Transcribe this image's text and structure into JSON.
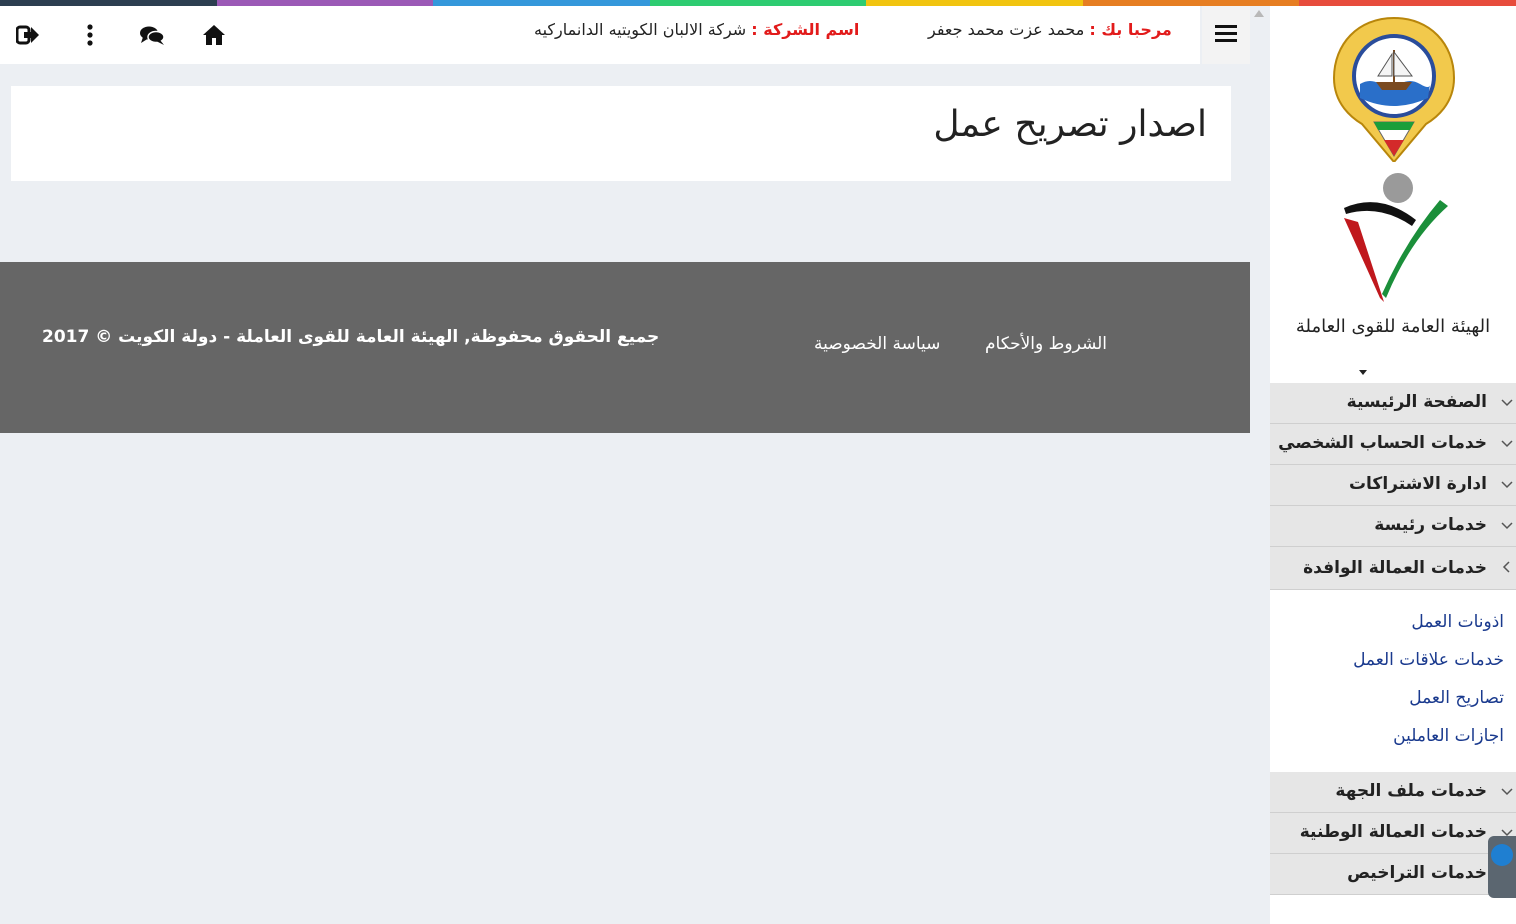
{
  "accent_colors": [
    "#2c3e50",
    "#9b59b6",
    "#3498db",
    "#2ecc71",
    "#f1c40f",
    "#e67e22",
    "#e74c3c"
  ],
  "header": {
    "welcome_label": "مرحبا بك :",
    "user_name": "محمد عزت محمد جعفر",
    "company_label": "اسم الشركة :",
    "company_name": "شركة الالبان الكويتيه الدانماركيه",
    "icons": [
      "logout-icon",
      "more-vertical-icon",
      "chat-icon",
      "home-icon",
      "hamburger-menu-icon"
    ]
  },
  "main": {
    "page_title": "اصدار تصريح عمل"
  },
  "footer": {
    "copyright": "جميع الحقوق محفوظة, الهيئة العامة للقوى العاملة - دولة الكويت © 2017",
    "links": [
      "الشروط والأحكام",
      "سياسة الخصوصية"
    ]
  },
  "sidebar": {
    "org_name": "الهيئة العامة للقوى العاملة",
    "items": [
      {
        "label": "الصفحة الرئيسية"
      },
      {
        "label": "خدمات الحساب الشخصي"
      },
      {
        "label": "ادارة الاشتراكات"
      },
      {
        "label": "خدمات رئيسة"
      },
      {
        "label": "خدمات العمالة الوافدة",
        "expanded": true
      }
    ],
    "subitems": [
      "اذونات العمل",
      "خدمات علاقات العمل",
      "تصاريح العمل",
      "اجازات العاملين"
    ],
    "items_after": [
      {
        "label": "خدمات ملف الجهة"
      },
      {
        "label": "خدمات العمالة الوطنية"
      },
      {
        "label": "خدمات التراخيص"
      }
    ]
  }
}
